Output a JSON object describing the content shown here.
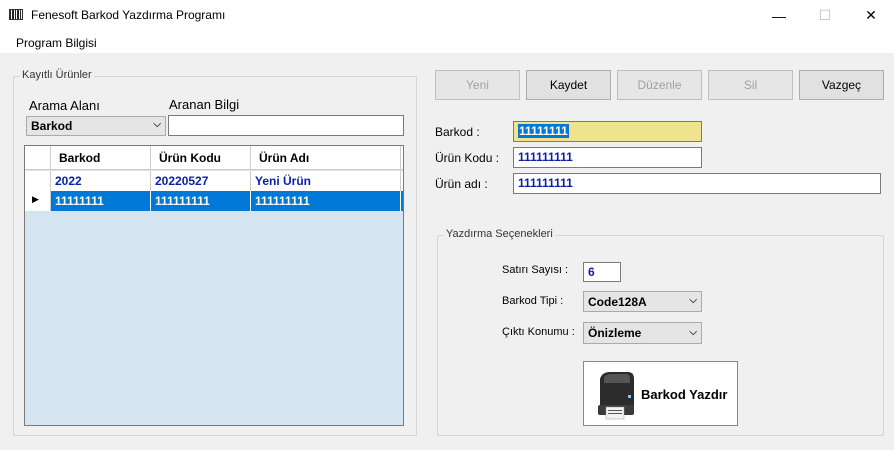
{
  "window": {
    "title": "Fenesoft Barkod Yazdırma Programı",
    "minimize": "—",
    "maximize": "☐",
    "close": "✕"
  },
  "menu": {
    "items": [
      "Program Bilgisi"
    ]
  },
  "left_panel": {
    "legend": "Kayıtlı Ürünler",
    "search_field_label": "Arama Alanı",
    "search_value_label": "Aranan Bilgi",
    "search_field_value": "Barkod",
    "search_value": "",
    "grid": {
      "columns": [
        "Barkod",
        "Ürün Kodu",
        "Ürün Adı"
      ],
      "rows": [
        {
          "barkod": "2022",
          "urun_kodu": "20220527",
          "urun_adi": "Yeni Ürün"
        },
        {
          "barkod": "11111111",
          "urun_kodu": "111111111",
          "urun_adi": "111111111"
        }
      ],
      "selected_row_marker": "▶"
    }
  },
  "toolbar": {
    "new_label": "Yeni",
    "save_label": "Kaydet",
    "edit_label": "Düzenle",
    "delete_label": "Sil",
    "cancel_label": "Vazgeç"
  },
  "form": {
    "barkod_label": "Barkod :",
    "barkod_value": "11111111",
    "urun_kodu_label": "Ürün Kodu :",
    "urun_kodu_value": "111111111",
    "urun_adi_label": "Ürün adı :",
    "urun_adi_value": "111111111"
  },
  "print_options": {
    "legend": "Yazdırma Seçenekleri",
    "count_label": "Satırı Sayısı :",
    "count_value": "6",
    "type_label": "Barkod Tipi :",
    "type_value": "Code128A",
    "output_label": "Çıktı Konumu :",
    "output_value": "Önizleme",
    "print_button_label": "Barkod Yazdır"
  },
  "colors": {
    "accent": "#0078d7",
    "value_text": "#0a1fa8",
    "highlight_field": "#f0e38e"
  }
}
